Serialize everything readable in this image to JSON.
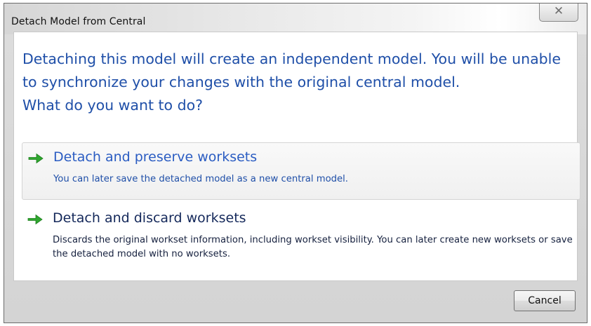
{
  "window": {
    "title": "Detach Model from Central",
    "close_glyph": "✕"
  },
  "main_instruction": "Detaching this model will create an independent model. You will be unable to synchronize your changes with the original central model.\nWhat do you want to do?",
  "commands": [
    {
      "icon": "green-arrow-icon",
      "title": "Detach and preserve worksets",
      "description": "You can later save the detached model as a new central model."
    },
    {
      "icon": "green-arrow-icon",
      "title": "Detach and discard worksets",
      "description": "Discards the original workset information, including workset visibility. You can later create new worksets or save the detached model with no worksets."
    }
  ],
  "footer": {
    "cancel_label": "Cancel"
  },
  "colors": {
    "instruction_blue": "#1f4fa8",
    "arrow_green": "#2fa62f"
  }
}
